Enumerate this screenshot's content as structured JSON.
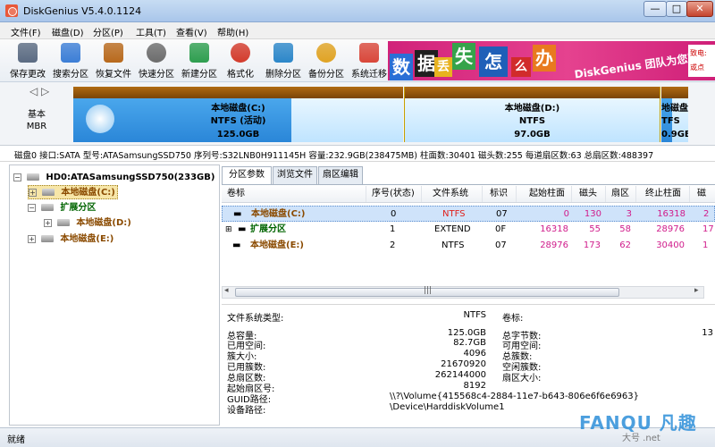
{
  "window": {
    "title": "DiskGenius V5.4.0.1124"
  },
  "menu": [
    "文件(F)",
    "磁盘(D)",
    "分区(P)",
    "工具(T)",
    "查看(V)",
    "帮助(H)"
  ],
  "toolbar": [
    {
      "label": "保存更改",
      "icon": "save-icon",
      "color": "#5b6b82"
    },
    {
      "label": "搜索分区",
      "icon": "search-partition-icon",
      "color": "#3c7ed6"
    },
    {
      "label": "恢复文件",
      "icon": "recover-file-icon",
      "color": "#b8691c"
    },
    {
      "label": "快速分区",
      "icon": "quick-partition-icon",
      "color": "#6c6c6c"
    },
    {
      "label": "新建分区",
      "icon": "new-partition-icon",
      "color": "#2e9e4f"
    },
    {
      "label": "格式化",
      "icon": "format-icon",
      "color": "#d33b2c"
    },
    {
      "label": "删除分区",
      "icon": "delete-partition-icon",
      "color": "#2c87c9"
    },
    {
      "label": "备份分区",
      "icon": "backup-partition-icon",
      "color": "#e0a323"
    },
    {
      "label": "系统迁移",
      "icon": "system-migrate-icon",
      "color": "#d9473a"
    }
  ],
  "banner": {
    "chars": [
      {
        "text": "数",
        "color": "#2a6fd6"
      },
      {
        "text": "据",
        "color": "#1f1f1f"
      },
      {
        "text": "丢",
        "color": "#e8b21f"
      },
      {
        "text": "失",
        "color": "#35a34a"
      },
      {
        "text": "怎",
        "color": "#1f5fb8"
      },
      {
        "text": "么",
        "color": "#d12b2b"
      },
      {
        "text": "办",
        "color": "#e87a1f"
      }
    ],
    "slogan": "DiskGenius 团队为您服务",
    "side_top": "致电:",
    "side_bottom": "或点"
  },
  "diskmap": {
    "nav": "◁ ▷",
    "disk_label_1": "基本",
    "disk_label_2": "MBR",
    "partitions": [
      {
        "name": "本地磁盘(C:)",
        "fs": "NTFS (活动)",
        "size": "125.0GB",
        "used_fraction": 0.66
      },
      {
        "name": "本地磁盘(D:)",
        "fs": "NTFS",
        "size": "97.0GB",
        "used_fraction": 0.0
      },
      {
        "name": "地磁盘",
        "fs": "TFS",
        "size": "0.9GB",
        "used_fraction": 0.4
      }
    ]
  },
  "diskinfo": "磁盘0 接口:SATA  型号:ATASamsungSSD750  序列号:S32LNB0H911145H  容量:232.9GB(238475MB)  柱面数:30401  磁头数:255  每道扇区数:63  总扇区数:488397",
  "tree": {
    "disk": "HD0:ATASamsungSSD750(233GB)",
    "c": "本地磁盘(C:)",
    "ext": "扩展分区",
    "d": "本地磁盘(D:)",
    "e": "本地磁盘(E:)",
    "plus": "+",
    "minus": "−"
  },
  "tabs": [
    "分区参数",
    "浏览文件",
    "扇区编辑"
  ],
  "grid": {
    "headers": [
      "卷标",
      "序号(状态)",
      "文件系统",
      "标识",
      "起始柱面",
      "磁头",
      "扇区",
      "终止柱面",
      "磁"
    ],
    "rows": [
      {
        "name": "本地磁盘(C:)",
        "index": "0",
        "fs": "NTFS",
        "id": "07",
        "start_cyl": "0",
        "head": "130",
        "sector": "3",
        "end_cyl": "16318",
        "extra": "2"
      },
      {
        "name": "扩展分区",
        "index": "1",
        "fs": "EXTEND",
        "id": "0F",
        "start_cyl": "16318",
        "head": "55",
        "sector": "58",
        "end_cyl": "28976",
        "extra": "17"
      },
      {
        "name": "本地磁盘(E:)",
        "index": "2",
        "fs": "NTFS",
        "id": "07",
        "start_cyl": "28976",
        "head": "173",
        "sector": "62",
        "end_cyl": "30400",
        "extra": "1"
      }
    ]
  },
  "details": {
    "fs_type_label": "文件系统类型:",
    "fs_type_value": "NTFS",
    "volume_label": "卷标:",
    "left": [
      {
        "label": "总容量:",
        "value": "125.0GB"
      },
      {
        "label": "已用空间:",
        "value": "82.7GB"
      },
      {
        "label": "簇大小:",
        "value": "4096"
      },
      {
        "label": "已用簇数:",
        "value": "21670920"
      },
      {
        "label": "总扇区数:",
        "value": "262144000"
      },
      {
        "label": "起始扇区号:",
        "value": "8192"
      }
    ],
    "right": [
      {
        "label": "总字节数:",
        "value": "13"
      },
      {
        "label": "可用空间:",
        "value": ""
      },
      {
        "label": "总簇数:",
        "value": ""
      },
      {
        "label": "空闲簇数:",
        "value": ""
      },
      {
        "label": "扇区大小:",
        "value": ""
      }
    ],
    "guid_label": "GUID路径:",
    "guid_value": "\\\\?\\Volume{415568c4-2884-11e7-b643-806e6f6e6963}",
    "device_label": "设备路径:",
    "device_value": "\\Device\\HarddiskVolume1"
  },
  "status": "就绪",
  "watermark": {
    "text": "FANQU 凡趣",
    "sub": "大号 .net"
  }
}
